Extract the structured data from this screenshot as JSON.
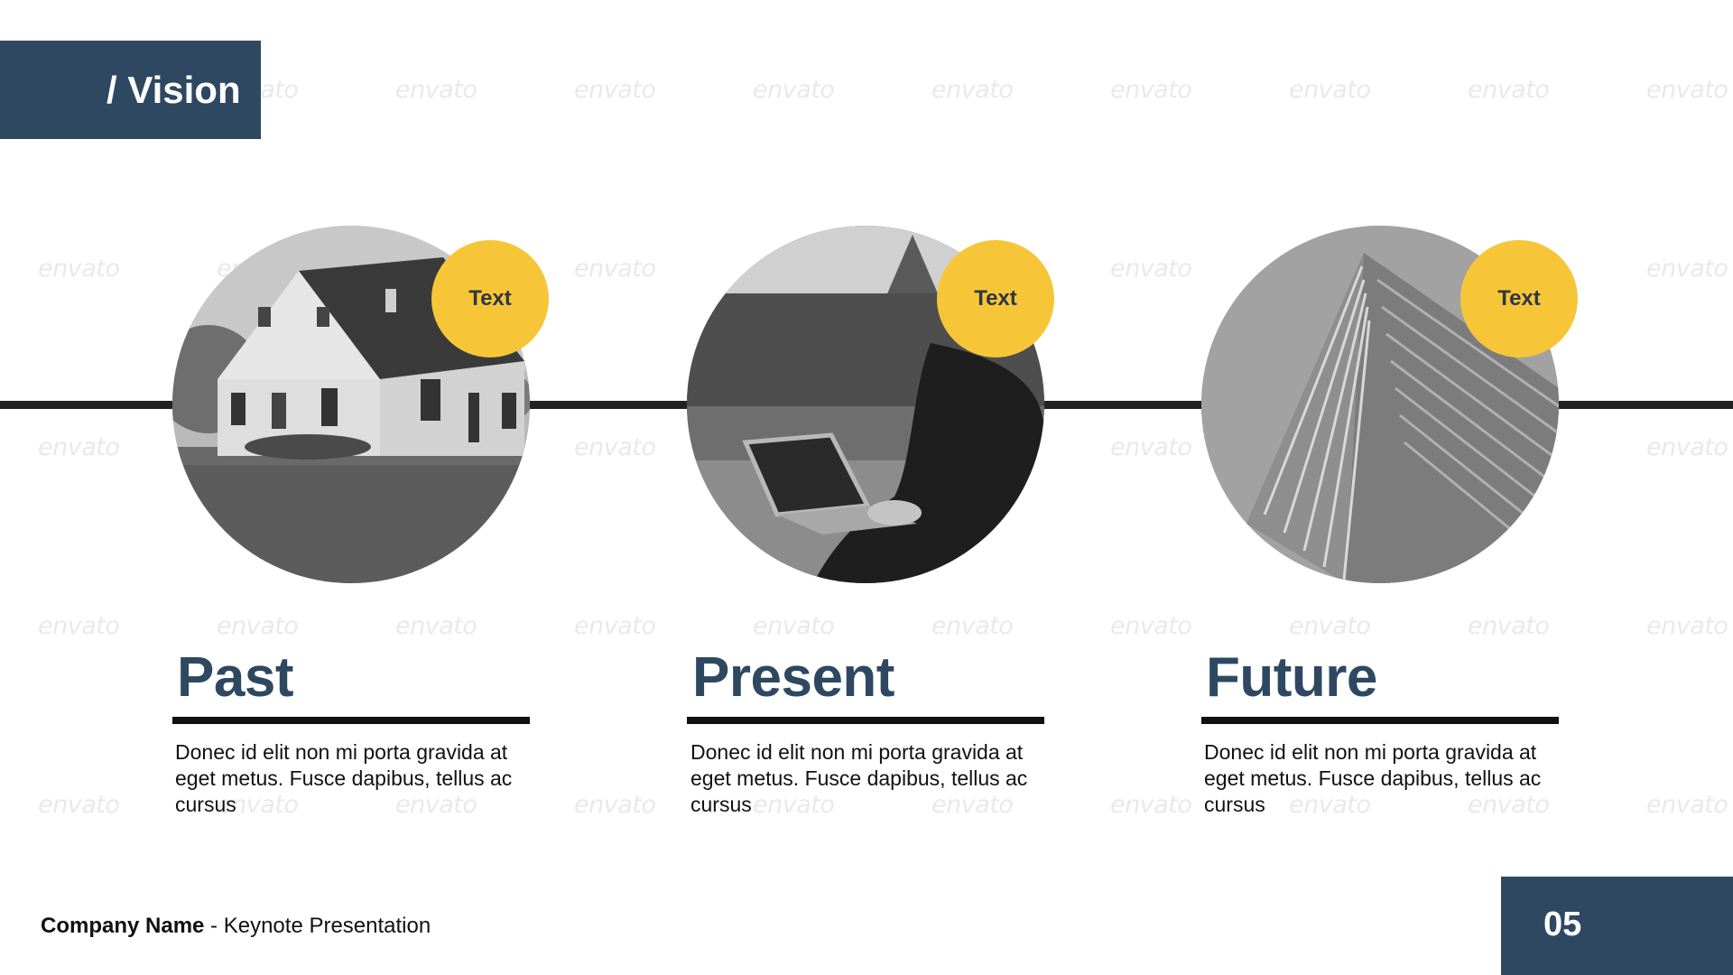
{
  "slide": {
    "title": "/ Vision",
    "watermark": "envato",
    "colors": {
      "navy": "#2e4862",
      "yellow": "#f7c638",
      "line": "#222222"
    }
  },
  "columns": [
    {
      "heading": "Past",
      "badge": "Text",
      "body": "Donec id elit non mi porta gravida at eget metus. Fusce dapibus, tellus ac cursus",
      "image": "house-photo"
    },
    {
      "heading": "Present",
      "badge": "Text",
      "body": "Donec id elit non mi porta gravida at eget metus. Fusce dapibus, tellus ac cursus",
      "image": "laptop-photo"
    },
    {
      "heading": "Future",
      "badge": "Text",
      "body": "Donec id elit non mi porta gravida at eget metus. Fusce dapibus, tellus ac cursus",
      "image": "skyscraper-photo"
    }
  ],
  "footer": {
    "company": "Company Name",
    "subtitle": " - Keynote Presentation",
    "page_number": "05"
  }
}
